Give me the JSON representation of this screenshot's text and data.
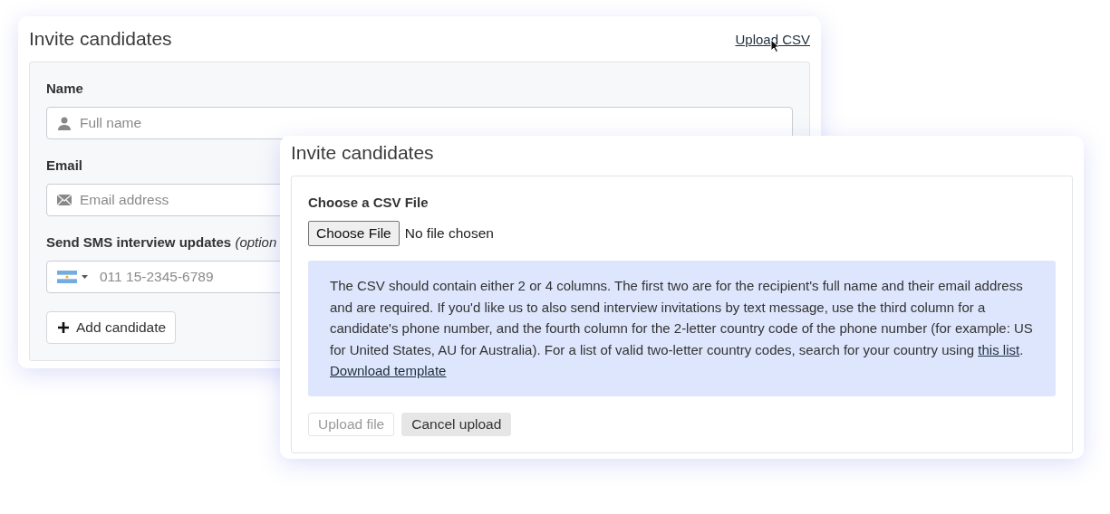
{
  "invite_form": {
    "title": "Invite candidates",
    "upload_link": "Upload CSV",
    "name": {
      "label": "Name",
      "placeholder": "Full name"
    },
    "email": {
      "label": "Email",
      "placeholder": "Email address"
    },
    "sms": {
      "label": "Send SMS interview updates",
      "optional": "(option",
      "placeholder": "011 15-2345-6789"
    },
    "add_button": "Add candidate"
  },
  "csv_dialog": {
    "title": "Invite candidates",
    "file_label": "Choose a CSV File",
    "file_button": "Choose File",
    "file_status": "No file chosen",
    "info": {
      "text": "The CSV should contain either 2 or 4 columns. The first two are for the recipient's full name and their email address and are required. If you'd like us to also send interview invitations by text message, use the third column for a candidate's phone number, and the fourth column for the 2-letter country code of the phone number (for example: US for United States, AU for Australia). For a list of valid two-letter country codes, search for your country using ",
      "link": "this list",
      "after": ".",
      "template_link": "Download template"
    },
    "buttons": [
      {
        "label": "Upload file",
        "disabled": true
      },
      {
        "label": "Cancel upload",
        "disabled": false
      }
    ]
  }
}
